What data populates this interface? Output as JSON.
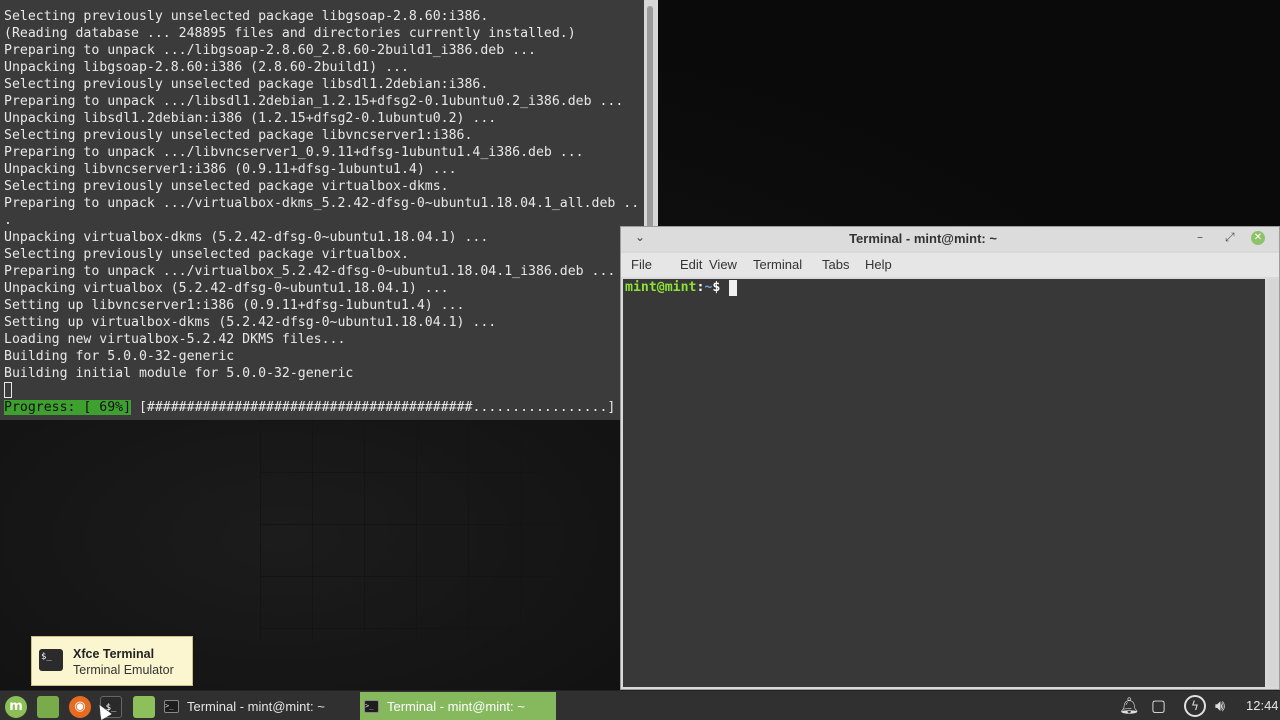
{
  "background_terminal": {
    "lines": [
      "Selecting previously unselected package libgsoap-2.8.60:i386.",
      "(Reading database ... 248895 files and directories currently installed.)",
      "Preparing to unpack .../libgsoap-2.8.60_2.8.60-2build1_i386.deb ...",
      "Unpacking libgsoap-2.8.60:i386 (2.8.60-2build1) ...",
      "Selecting previously unselected package libsdl1.2debian:i386.",
      "Preparing to unpack .../libsdl1.2debian_1.2.15+dfsg2-0.1ubuntu0.2_i386.deb ...",
      "Unpacking libsdl1.2debian:i386 (1.2.15+dfsg2-0.1ubuntu0.2) ...",
      "Selecting previously unselected package libvncserver1:i386.",
      "Preparing to unpack .../libvncserver1_0.9.11+dfsg-1ubuntu1.4_i386.deb ...",
      "Unpacking libvncserver1:i386 (0.9.11+dfsg-1ubuntu1.4) ...",
      "Selecting previously unselected package virtualbox-dkms.",
      "Preparing to unpack .../virtualbox-dkms_5.2.42-dfsg-0~ubuntu1.18.04.1_all.deb ..",
      ".",
      "Unpacking virtualbox-dkms (5.2.42-dfsg-0~ubuntu1.18.04.1) ...",
      "Selecting previously unselected package virtualbox.",
      "Preparing to unpack .../virtualbox_5.2.42-dfsg-0~ubuntu1.18.04.1_i386.deb ...",
      "Unpacking virtualbox (5.2.42-dfsg-0~ubuntu1.18.04.1) ...",
      "Setting up libvncserver1:i386 (0.9.11+dfsg-1ubuntu1.4) ...",
      "Setting up virtualbox-dkms (5.2.42-dfsg-0~ubuntu1.18.04.1) ...",
      "Loading new virtualbox-5.2.42 DKMS files...",
      "Building for 5.0.0-32-generic",
      "Building initial module for 5.0.0-32-generic"
    ],
    "progress_label": "Progress: [ 69%]",
    "progress_bar": " [#########################################.................]",
    "progress_percent": 69
  },
  "terminal_window": {
    "title": "Terminal - mint@mint: ~",
    "menu": [
      "File",
      "Edit",
      "View",
      "Terminal",
      "Tabs",
      "Help"
    ],
    "prompt_user": "mint@mint",
    "prompt_sep": ":",
    "prompt_dir": "~",
    "prompt_symbol": "$"
  },
  "tooltip": {
    "title": "Xfce Terminal",
    "subtitle": "Terminal Emulator"
  },
  "taskbar": {
    "tasks": [
      {
        "label": "Terminal - mint@mint: ~",
        "active": false
      },
      {
        "label": "Terminal - mint@mint: ~",
        "active": true
      }
    ],
    "clock": "12:44"
  },
  "colors": {
    "accent_green": "#86b95e",
    "progress_green": "#3da02f",
    "prompt_green": "#8ae234",
    "terminal_bg": "#383838"
  }
}
